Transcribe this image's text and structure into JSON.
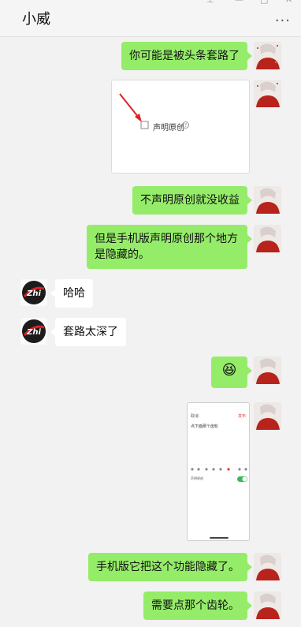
{
  "window": {
    "title": "小威",
    "controls": [
      "⊤",
      "□",
      "▢",
      "✕"
    ],
    "more": "···"
  },
  "image1": {
    "checkbox_label": "声明原创",
    "info": "?"
  },
  "messages": {
    "m1": "你可能是被头条套路了",
    "m2": "不声明原创就没收益",
    "m3": "但是手机版声明原创那个地方\n是隐藏的。",
    "m4": "哈哈",
    "m5": "套路太深了",
    "m6": "😆",
    "m7": "手机版它把这个功能隐藏了。",
    "m8": "需要点那个齿轮。"
  },
  "phone_screenshot": {
    "top_left": "取消",
    "top_right": "发布",
    "body_text": "点下面那个齿轮",
    "option_label": "声明原创"
  },
  "other_avatar_text": "Zhi"
}
